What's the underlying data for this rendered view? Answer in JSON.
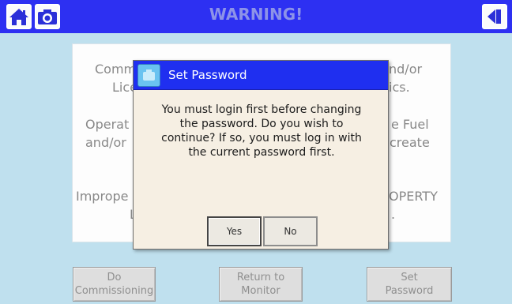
{
  "header": {
    "title": "WARNING!",
    "home_icon": "home-icon",
    "camera_icon": "camera-icon",
    "back_icon": "back-arrow-icon",
    "bar_color": "#2d30f2"
  },
  "warning_panel": {
    "line1_left": "Comm",
    "line2_left": "Lice",
    "line1_right": "nd/or",
    "line2_right": "ics.",
    "line3_left": "Operat",
    "line4_left": "and/or",
    "line3_right": "e Fuel",
    "line4_right": "create",
    "line5_left": "Imprope",
    "line6_left": "L",
    "line5_right": "OPERTY",
    "line6_right": "."
  },
  "dialog": {
    "title": "Set Password",
    "message": "You must login first before changing the password. Do you wish to continue? If so, you must log in with the current password first.",
    "message_lines": [
      "You must login first before changing",
      "the password. Do you wish to",
      "continue? If so, you must log in with",
      "the current password first."
    ],
    "yes_label": "Yes",
    "no_label": "No",
    "title_color": "#1f2ff0"
  },
  "bottom_buttons": [
    {
      "line1": "Do",
      "line2": "Commissioning"
    },
    {
      "line1": "Return to",
      "line2": "Monitor"
    },
    {
      "line1": "Set",
      "line2": "Password"
    }
  ]
}
